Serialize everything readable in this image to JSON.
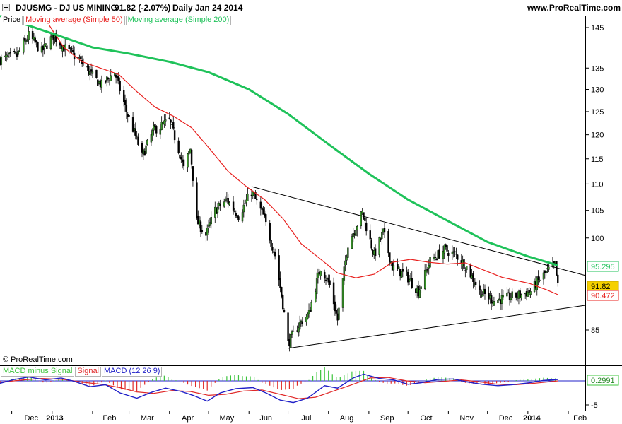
{
  "header": {
    "symbol": "DJUSMG - DJ US MINING",
    "price_change": "91.82 (-2.07%)",
    "period": "Daily",
    "date": "Jan 24 2014",
    "site": "www.ProRealTime.com"
  },
  "legend": {
    "price": "Price",
    "ma50": "Moving average (Simple 50)",
    "ma200": "Moving average (Simple 200)",
    "macd_hist": "MACD minus Signal",
    "signal": "Signal",
    "macd": "MACD (12 26 9)"
  },
  "credit": "© ProRealTime.com",
  "colors": {
    "candle_up": "#2a6e1e",
    "candle_down": "#000000",
    "ma50": "#e8201e",
    "ma200": "#1fc25a",
    "trendline": "#000000",
    "macd": "#2020c8",
    "signal": "#e02828",
    "hist_pos": "#3cc43c",
    "hist_neg": "#e02828"
  },
  "chart_data": [
    {
      "type": "candlestick",
      "title": "DJUSMG - DJ US MINING",
      "y_scale": "log",
      "ylim": [
        80,
        148
      ],
      "y_ticks": [
        "145",
        "135",
        "130",
        "125",
        "120",
        "115",
        "110",
        "105",
        "100",
        "85"
      ],
      "x_ticks": [
        "Dec",
        "2013",
        "Feb",
        "Mar",
        "Apr",
        "May",
        "Jun",
        "Jul",
        "Aug",
        "Sep",
        "Oct",
        "Nov",
        "Dec",
        "2014",
        "Feb"
      ],
      "x_range": [
        "2012-11-22",
        "2014-02-14"
      ],
      "close_path": [
        [
          "2012-11-22",
          137
        ],
        [
          "2012-12-05",
          138
        ],
        [
          "2012-12-14",
          143
        ],
        [
          "2012-12-24",
          139
        ],
        [
          "2013-01-02",
          143
        ],
        [
          "2013-01-10",
          140
        ],
        [
          "2013-01-22",
          137
        ],
        [
          "2013-02-01",
          133
        ],
        [
          "2013-02-08",
          131
        ],
        [
          "2013-02-18",
          134
        ],
        [
          "2013-02-27",
          125
        ],
        [
          "2013-03-07",
          119
        ],
        [
          "2013-03-11",
          115.5
        ],
        [
          "2013-03-20",
          121
        ],
        [
          "2013-04-01",
          123
        ],
        [
          "2013-04-08",
          117
        ],
        [
          "2013-04-12",
          113
        ],
        [
          "2013-04-17",
          117
        ],
        [
          "2013-04-22",
          103
        ],
        [
          "2013-04-29",
          100.5
        ],
        [
          "2013-05-06",
          105
        ],
        [
          "2013-05-15",
          107
        ],
        [
          "2013-05-24",
          104
        ],
        [
          "2013-06-03",
          108.5
        ],
        [
          "2013-06-12",
          104
        ],
        [
          "2013-06-21",
          97
        ],
        [
          "2013-06-27",
          89
        ],
        [
          "2013-07-01",
          83
        ],
        [
          "2013-07-10",
          86
        ],
        [
          "2013-07-17",
          87.5
        ],
        [
          "2013-07-26",
          95
        ],
        [
          "2013-08-02",
          92
        ],
        [
          "2013-08-08",
          86.5
        ],
        [
          "2013-08-16",
          99
        ],
        [
          "2013-08-27",
          104.5
        ],
        [
          "2013-09-05",
          97
        ],
        [
          "2013-09-12",
          101
        ],
        [
          "2013-09-19",
          95
        ],
        [
          "2013-09-30",
          93.5
        ],
        [
          "2013-10-09",
          91
        ],
        [
          "2013-10-18",
          96
        ],
        [
          "2013-10-29",
          98
        ],
        [
          "2013-11-07",
          97
        ],
        [
          "2013-11-15",
          95
        ],
        [
          "2013-11-25",
          91
        ],
        [
          "2013-12-06",
          89.5
        ],
        [
          "2013-12-16",
          90
        ],
        [
          "2013-12-27",
          90.5
        ],
        [
          "2014-01-03",
          91
        ],
        [
          "2014-01-10",
          93
        ],
        [
          "2014-01-17",
          94.5
        ],
        [
          "2014-01-22",
          95.3
        ],
        [
          "2014-01-24",
          91.82
        ]
      ],
      "series": [
        {
          "name": "Moving average (Simple 50)",
          "last": 90.472,
          "points": [
            [
              "2012-12-27",
              147
            ],
            [
              "2013-01-10",
              140
            ],
            [
              "2013-01-24",
              136.5
            ],
            [
              "2013-02-07",
              135
            ],
            [
              "2013-02-21",
              133.5
            ],
            [
              "2013-03-07",
              129.5
            ],
            [
              "2013-03-21",
              126
            ],
            [
              "2013-04-04",
              124
            ],
            [
              "2013-04-18",
              121.5
            ],
            [
              "2013-05-02",
              117
            ],
            [
              "2013-05-16",
              112.5
            ],
            [
              "2013-05-30",
              109.5
            ],
            [
              "2013-06-13",
              107
            ],
            [
              "2013-06-27",
              103.5
            ],
            [
              "2013-07-11",
              99
            ],
            [
              "2013-07-25",
              96.5
            ],
            [
              "2013-08-08",
              94
            ],
            [
              "2013-08-22",
              93.2
            ],
            [
              "2013-09-05",
              93.8
            ],
            [
              "2013-09-19",
              95.8
            ],
            [
              "2013-10-03",
              96.3
            ],
            [
              "2013-10-17",
              95.8
            ],
            [
              "2013-10-31",
              95.5
            ],
            [
              "2013-11-14",
              95.7
            ],
            [
              "2013-11-28",
              94.5
            ],
            [
              "2013-12-12",
              93.3
            ],
            [
              "2014-01-02",
              92.3
            ],
            [
              "2014-01-16",
              91.2
            ],
            [
              "2014-01-24",
              90.472
            ]
          ]
        },
        {
          "name": "Moving average (Simple 200)",
          "last": 95.295,
          "points": [
            [
              "2012-11-22",
              148
            ],
            [
              "2013-01-01",
              143.5
            ],
            [
              "2013-02-01",
              140
            ],
            [
              "2013-03-01",
              138.5
            ],
            [
              "2013-04-01",
              136.5
            ],
            [
              "2013-05-01",
              134
            ],
            [
              "2013-06-01",
              130
            ],
            [
              "2013-07-01",
              124.5
            ],
            [
              "2013-08-01",
              118
            ],
            [
              "2013-09-01",
              112
            ],
            [
              "2013-10-01",
              107
            ],
            [
              "2013-11-01",
              103
            ],
            [
              "2013-12-01",
              99.3
            ],
            [
              "2014-01-01",
              96.8
            ],
            [
              "2014-01-24",
              95.295
            ]
          ]
        }
      ],
      "trendlines": [
        {
          "from": [
            "2013-06-03",
            109.5
          ],
          "to": [
            "2014-02-14",
            93.6
          ]
        },
        {
          "from": [
            "2013-07-01",
            82.3
          ],
          "to": [
            "2014-02-14",
            88.8
          ]
        }
      ],
      "value_labels": [
        "95.295",
        "91.82",
        "90.472"
      ]
    },
    {
      "type": "line",
      "title": "MACD (12 26 9)",
      "ylim": [
        -5.5,
        2
      ],
      "y_ticks": [
        "-5"
      ],
      "last": 0.2991,
      "series": [
        {
          "name": "MACD (12 26 9)",
          "points": [
            [
              "2012-11-22",
              -0.5
            ],
            [
              "2012-12-03",
              0.3
            ],
            [
              "2012-12-14",
              0.8
            ],
            [
              "2012-12-27",
              0.2
            ],
            [
              "2013-01-08",
              0.6
            ],
            [
              "2013-01-18",
              -0.1
            ],
            [
              "2013-01-30",
              -1.2
            ],
            [
              "2013-02-11",
              -0.8
            ],
            [
              "2013-02-22",
              -2.5
            ],
            [
              "2013-03-07",
              -3.6
            ],
            [
              "2013-03-18",
              -2.4
            ],
            [
              "2013-03-29",
              -1.5
            ],
            [
              "2013-04-10",
              -2.2
            ],
            [
              "2013-04-19",
              -3.0
            ],
            [
              "2013-04-30",
              -4.2
            ],
            [
              "2013-05-10",
              -2.5
            ],
            [
              "2013-05-22",
              -1.6
            ],
            [
              "2013-06-04",
              -1.4
            ],
            [
              "2013-06-14",
              -2.5
            ],
            [
              "2013-06-25",
              -4.0
            ],
            [
              "2013-07-05",
              -4.5
            ],
            [
              "2013-07-16",
              -3.6
            ],
            [
              "2013-07-29",
              -1.0
            ],
            [
              "2013-08-08",
              -1.5
            ],
            [
              "2013-08-20",
              0.6
            ],
            [
              "2013-08-28",
              1.4
            ],
            [
              "2013-09-09",
              0.5
            ],
            [
              "2013-09-20",
              0.2
            ],
            [
              "2013-10-01",
              -0.7
            ],
            [
              "2013-10-11",
              -0.4
            ],
            [
              "2013-10-24",
              0.3
            ],
            [
              "2013-11-05",
              0.4
            ],
            [
              "2013-11-15",
              -0.2
            ],
            [
              "2013-11-27",
              -0.7
            ],
            [
              "2013-12-09",
              -1.0
            ],
            [
              "2013-12-20",
              -0.8
            ],
            [
              "2014-01-02",
              -0.4
            ],
            [
              "2014-01-13",
              0.1
            ],
            [
              "2014-01-24",
              0.2991
            ]
          ]
        },
        {
          "name": "Signal",
          "points": [
            [
              "2012-11-22",
              -0.3
            ],
            [
              "2012-12-10",
              0.2
            ],
            [
              "2012-12-24",
              0.5
            ],
            [
              "2013-01-10",
              0.3
            ],
            [
              "2013-01-25",
              -0.3
            ],
            [
              "2013-02-08",
              -0.7
            ],
            [
              "2013-02-22",
              -1.4
            ],
            [
              "2013-03-07",
              -2.3
            ],
            [
              "2013-03-20",
              -2.6
            ],
            [
              "2013-04-03",
              -2.0
            ],
            [
              "2013-04-17",
              -2.2
            ],
            [
              "2013-05-01",
              -3.0
            ],
            [
              "2013-05-14",
              -2.8
            ],
            [
              "2013-05-28",
              -2.1
            ],
            [
              "2013-06-11",
              -1.9
            ],
            [
              "2013-06-25",
              -2.8
            ],
            [
              "2013-07-09",
              -3.7
            ],
            [
              "2013-07-22",
              -3.4
            ],
            [
              "2013-08-05",
              -2.1
            ],
            [
              "2013-08-19",
              -0.8
            ],
            [
              "2013-09-02",
              0.6
            ],
            [
              "2013-09-16",
              0.7
            ],
            [
              "2013-09-30",
              0.0
            ],
            [
              "2013-10-14",
              -0.4
            ],
            [
              "2013-10-28",
              -0.1
            ],
            [
              "2013-11-11",
              0.2
            ],
            [
              "2013-11-25",
              -0.2
            ],
            [
              "2013-12-09",
              -0.7
            ],
            [
              "2013-12-23",
              -0.8
            ],
            [
              "2014-01-06",
              -0.5
            ],
            [
              "2014-01-24",
              0.0
            ]
          ]
        }
      ]
    }
  ]
}
